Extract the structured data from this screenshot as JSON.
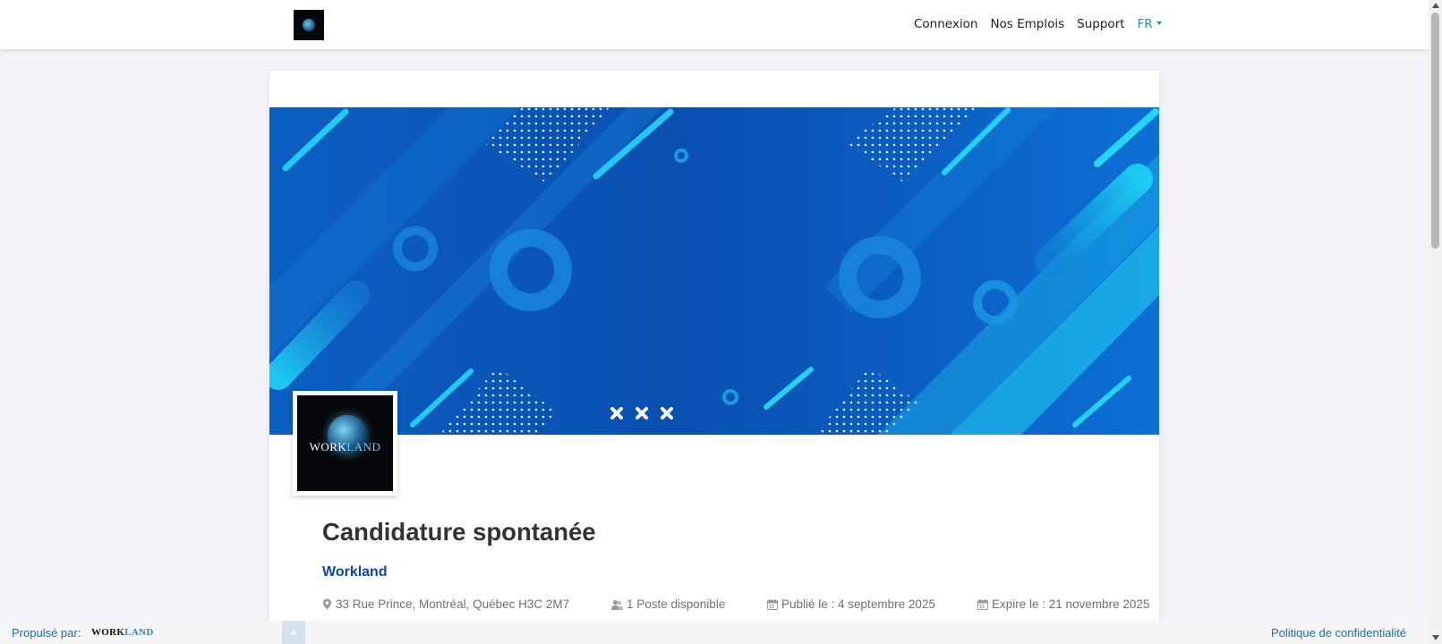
{
  "nav": {
    "logo_icon": "workland-globe-logo",
    "links": [
      "Connexion",
      "Nos Emplois",
      "Support"
    ],
    "language": "FR"
  },
  "job": {
    "title": "Candidature spontanée",
    "company": "Workland",
    "address": "33 Rue Prince, Montréal, Québec H3C 2M7",
    "positions": "1 Poste disponible",
    "published": "Publié le : 4 septembre 2025",
    "expires": "Expire le : 21 novembre 2025"
  },
  "company_logo": {
    "text_part1": "WORK",
    "text_part2": "LAND"
  },
  "footer": {
    "powered_by": "Propulsé par:",
    "brand_part1": "WORK",
    "brand_part2": "LAND",
    "privacy": "Politique de confidentialité"
  },
  "colors": {
    "link_blue": "#0f47a6",
    "accent": "#2a8bc8",
    "banner_blue": "#0a4fb0",
    "banner_cyan": "#1ed2f4"
  }
}
